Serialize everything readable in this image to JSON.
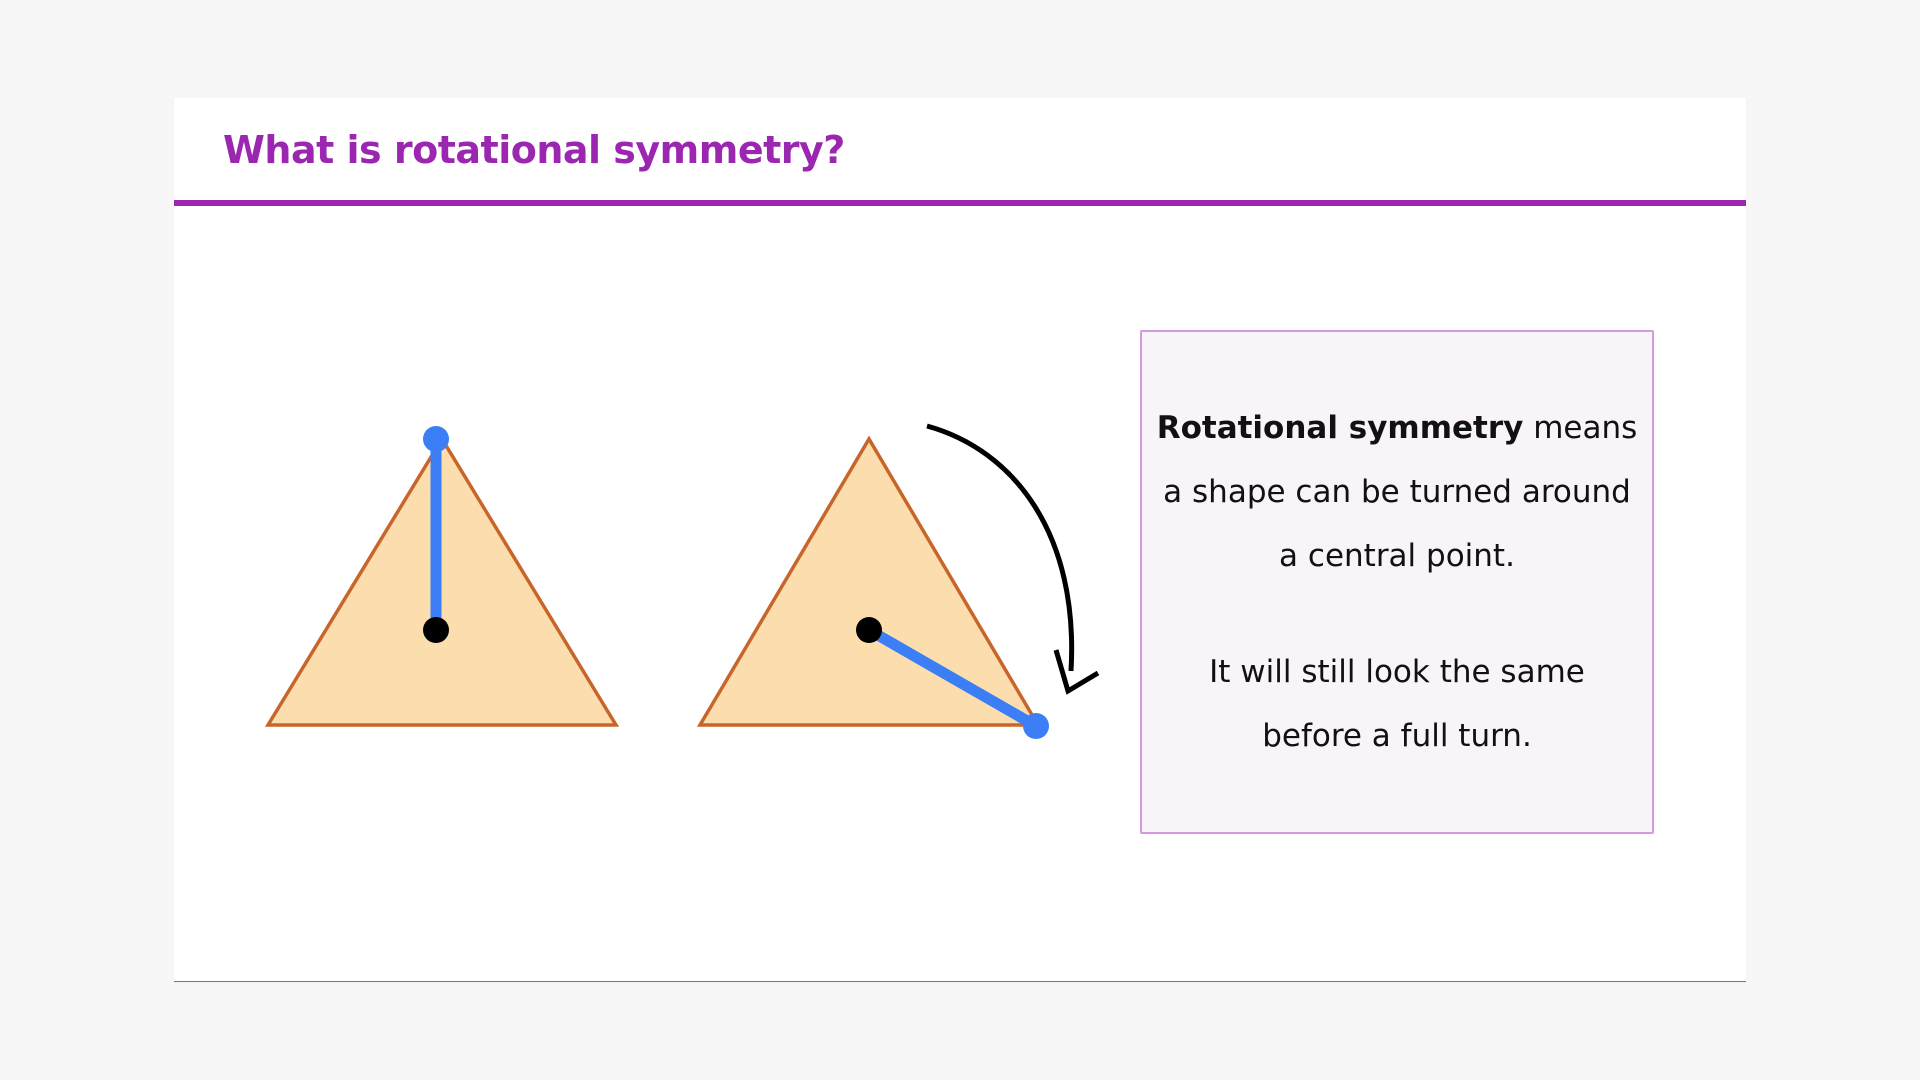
{
  "slide": {
    "title": "What is rotational symmetry?"
  },
  "info": {
    "term": "Rotational symmetry",
    "definition_rest": " means a shape can be turned around a central point.",
    "note": "It will still look the same before a full turn."
  },
  "colors": {
    "accent": "#9b27b0",
    "triangle_fill": "#fcdeae",
    "triangle_stroke": "#c8652a",
    "marker_line": "#3b7ef6",
    "center_point": "#000000",
    "box_fill": "#f9f3fa",
    "box_border": "#d39bde"
  },
  "diagram": {
    "shapes": [
      "equilateral-triangle-original",
      "equilateral-triangle-rotated"
    ],
    "rotation_indicator": "clockwise-arrow"
  }
}
